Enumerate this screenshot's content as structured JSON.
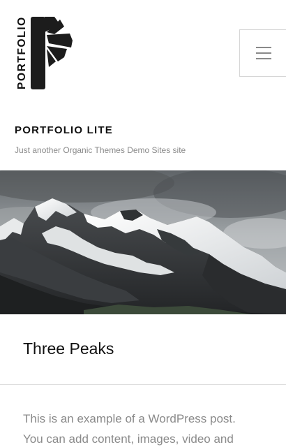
{
  "header": {
    "logo_text": "PORTFOLIO",
    "logo_icon": "portfolio-logo-icon",
    "menu_icon": "hamburger-menu-icon",
    "site_title": "PORTFOLIO LITE",
    "site_description": "Just another Organic Themes Demo Sites site"
  },
  "hero": {
    "image": "snowy-mountain-peaks-image"
  },
  "post": {
    "title": "Three Peaks",
    "excerpt_lines": [
      "This is an example of a WordPress post.",
      "You can add content, images, video and"
    ]
  }
}
